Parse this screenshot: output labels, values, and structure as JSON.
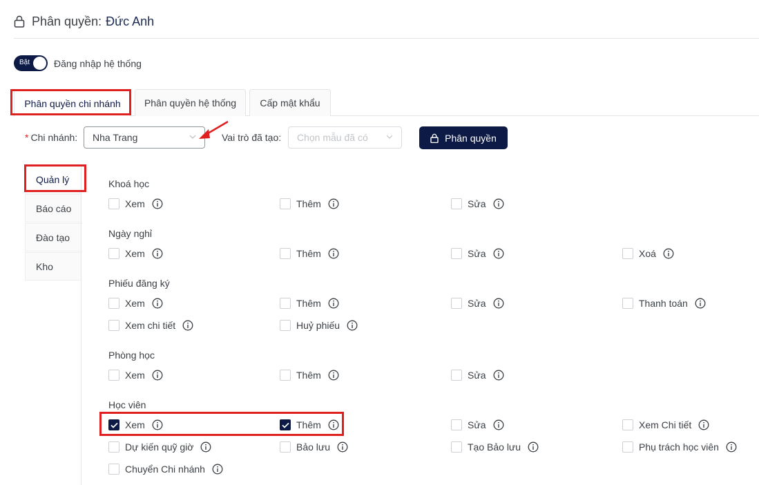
{
  "header": {
    "label": "Phân quyền:",
    "user_name": "Đức Anh"
  },
  "toggle": {
    "state_label": "Bật",
    "label": "Đăng nhập hệ thống"
  },
  "tabs": [
    {
      "label": "Phân quyền chi nhánh"
    },
    {
      "label": "Phân quyền hệ thống"
    },
    {
      "label": "Cấp mật khẩu"
    }
  ],
  "filters": {
    "branch_label": "Chi nhánh",
    "branch_value": "Nha Trang",
    "role_label": "Vai trò đã tạo",
    "role_placeholder": "Chọn mẫu đã có",
    "button_label": "Phân quyền"
  },
  "side_tabs": [
    {
      "label": "Quản lý"
    },
    {
      "label": "Báo cáo"
    },
    {
      "label": "Đào tạo"
    },
    {
      "label": "Kho"
    }
  ],
  "sections": [
    {
      "title": "Khoá học",
      "rows": [
        [
          {
            "label": "Xem",
            "checked": false
          },
          {
            "label": "Thêm",
            "checked": false
          },
          {
            "label": "Sửa",
            "checked": false
          }
        ]
      ]
    },
    {
      "title": "Ngày nghỉ",
      "rows": [
        [
          {
            "label": "Xem",
            "checked": false
          },
          {
            "label": "Thêm",
            "checked": false
          },
          {
            "label": "Sửa",
            "checked": false
          },
          {
            "label": "Xoá",
            "checked": false
          }
        ]
      ]
    },
    {
      "title": "Phiếu đăng ký",
      "rows": [
        [
          {
            "label": "Xem",
            "checked": false
          },
          {
            "label": "Thêm",
            "checked": false
          },
          {
            "label": "Sửa",
            "checked": false
          },
          {
            "label": "Thanh toán",
            "checked": false
          }
        ],
        [
          {
            "label": "Xem chi tiết",
            "checked": false
          },
          {
            "label": "Huỷ phiếu",
            "checked": false
          }
        ]
      ]
    },
    {
      "title": "Phòng học",
      "rows": [
        [
          {
            "label": "Xem",
            "checked": false
          },
          {
            "label": "Thêm",
            "checked": false
          },
          {
            "label": "Sửa",
            "checked": false
          }
        ]
      ]
    },
    {
      "title": "Học viên",
      "rows": [
        [
          {
            "label": "Xem",
            "checked": true
          },
          {
            "label": "Thêm",
            "checked": true
          },
          {
            "label": "Sửa",
            "checked": false
          },
          {
            "label": "Xem Chi tiết",
            "checked": false
          }
        ],
        [
          {
            "label": "Dự kiến quỹ giờ",
            "checked": false
          },
          {
            "label": "Bảo lưu",
            "checked": false
          },
          {
            "label": "Tạo Bảo lưu",
            "checked": false
          },
          {
            "label": "Phụ trách học viên",
            "checked": false
          }
        ],
        [
          {
            "label": "Chuyển Chi nhánh",
            "checked": false
          }
        ]
      ]
    }
  ],
  "colors": {
    "primary": "#0d1a45",
    "highlight": "#e02020"
  }
}
